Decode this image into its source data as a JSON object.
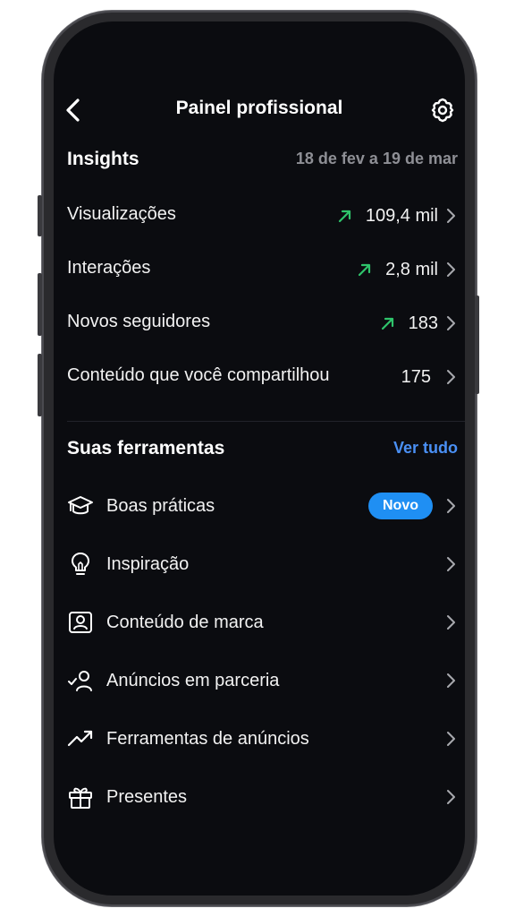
{
  "header": {
    "title": "Painel profissional"
  },
  "insights": {
    "title": "Insights",
    "date_range": "18 de fev a 19 de mar",
    "trend_color": "#2fc46b",
    "rows": [
      {
        "label": "Visualizações",
        "value": "109,4 mil",
        "trend": true
      },
      {
        "label": "Interações",
        "value": "2,8 mil",
        "trend": true
      },
      {
        "label": "Novos seguidores",
        "value": "183",
        "trend": true
      },
      {
        "label": "Conteúdo que você compartilhou",
        "value": "175",
        "trend": false
      }
    ]
  },
  "tools": {
    "title": "Suas ferramentas",
    "see_all": "Ver tudo",
    "accent": "#4a90f5",
    "items": [
      {
        "label": "Boas práticas",
        "icon": "graduation-cap-icon",
        "badge": "Novo"
      },
      {
        "label": "Inspiração",
        "icon": "lightbulb-icon"
      },
      {
        "label": "Conteúdo de marca",
        "icon": "branded-content-icon"
      },
      {
        "label": "Anúncios em parceria",
        "icon": "partnership-icon"
      },
      {
        "label": "Ferramentas de anúncios",
        "icon": "trend-up-icon"
      },
      {
        "label": "Presentes",
        "icon": "gift-icon"
      }
    ]
  }
}
